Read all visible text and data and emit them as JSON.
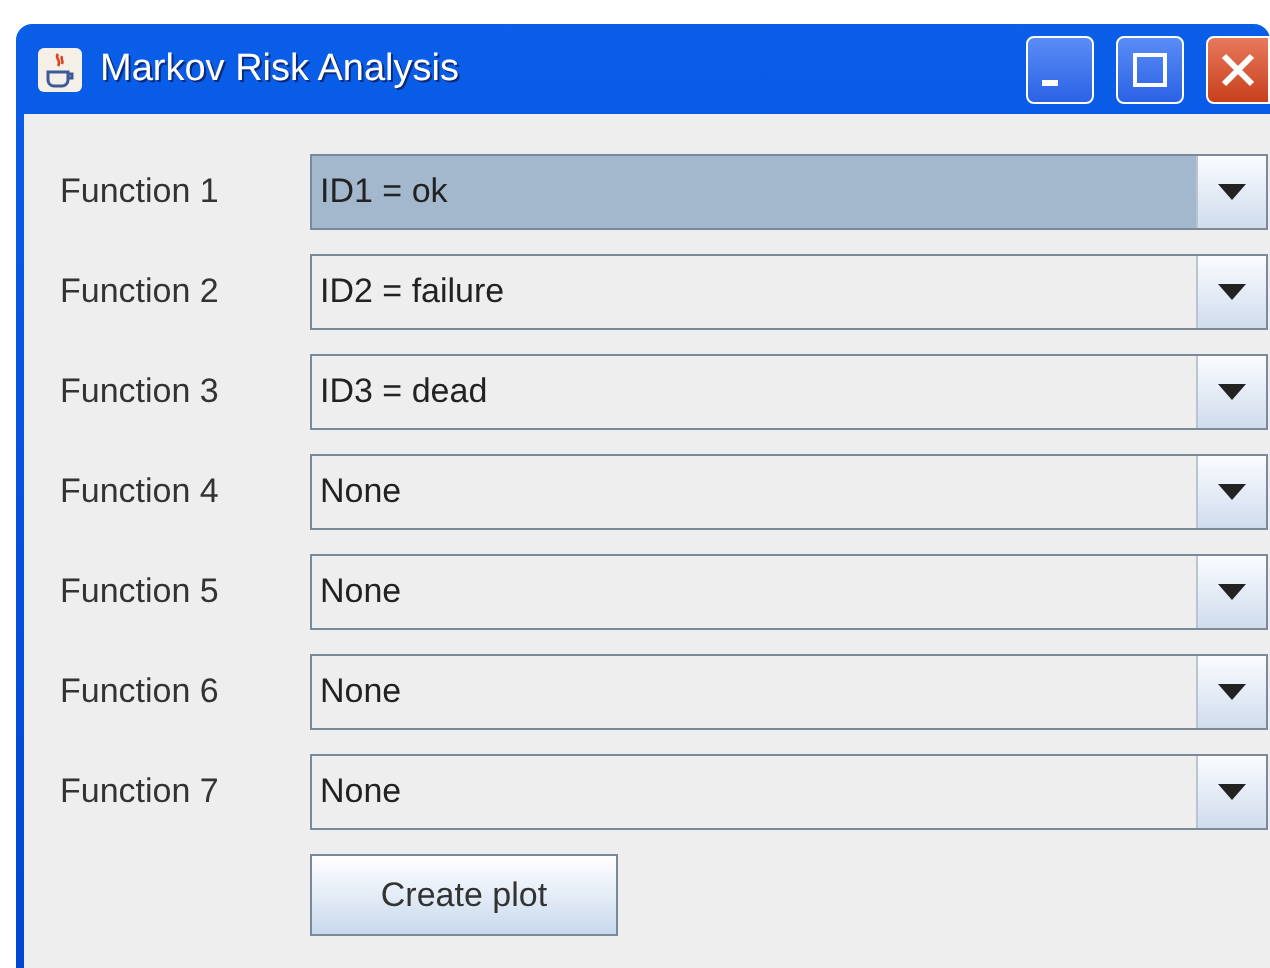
{
  "window": {
    "title": "Markov Risk Analysis"
  },
  "functions": [
    {
      "label": "Function 1",
      "value": "ID1 = ok",
      "selected": true
    },
    {
      "label": "Function 2",
      "value": "ID2 = failure",
      "selected": false
    },
    {
      "label": "Function 3",
      "value": "ID3 = dead",
      "selected": false
    },
    {
      "label": "Function 4",
      "value": "None",
      "selected": false
    },
    {
      "label": "Function 5",
      "value": "None",
      "selected": false
    },
    {
      "label": "Function 6",
      "value": "None",
      "selected": false
    },
    {
      "label": "Function 7",
      "value": "None",
      "selected": false
    }
  ],
  "buttons": [
    "Create plot"
  ]
}
